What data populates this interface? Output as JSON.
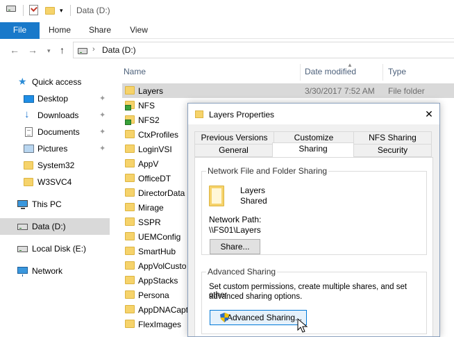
{
  "window": {
    "title": "Data (D:)"
  },
  "ribbon": {
    "tabs": [
      "File",
      "Home",
      "Share",
      "View"
    ]
  },
  "address": {
    "path": "Data (D:)"
  },
  "nav": {
    "items": [
      {
        "label": "Quick access",
        "icon": "star-icon",
        "pinned": false
      },
      {
        "label": "Desktop",
        "icon": "desktop-icon",
        "pinned": true
      },
      {
        "label": "Downloads",
        "icon": "download-icon",
        "pinned": true
      },
      {
        "label": "Documents",
        "icon": "documents-icon",
        "pinned": true
      },
      {
        "label": "Pictures",
        "icon": "pictures-icon",
        "pinned": true
      },
      {
        "label": "System32",
        "icon": "folder-icon",
        "pinned": false
      },
      {
        "label": "W3SVC4",
        "icon": "folder-icon",
        "pinned": false
      },
      {
        "label": "This PC",
        "icon": "pc-icon",
        "pinned": false
      },
      {
        "label": "Data (D:)",
        "icon": "drive-icon",
        "pinned": false,
        "selected": true
      },
      {
        "label": "Local Disk (E:)",
        "icon": "drive-icon",
        "pinned": false
      },
      {
        "label": "Network",
        "icon": "network-icon",
        "pinned": false
      }
    ]
  },
  "filelist": {
    "columns": {
      "name": "Name",
      "date": "Date modified",
      "type": "Type"
    },
    "rows": [
      {
        "name": "Layers",
        "date": "3/30/2017 7:52 AM",
        "type": "File folder",
        "selected": true,
        "shared": false
      },
      {
        "name": "NFS",
        "date": "",
        "type": "",
        "shared": true
      },
      {
        "name": "NFS2",
        "date": "",
        "type": "",
        "shared": true
      },
      {
        "name": "CtxProfiles",
        "date": "",
        "type": ""
      },
      {
        "name": "LoginVSI",
        "date": "",
        "type": ""
      },
      {
        "name": "AppV",
        "date": "",
        "type": ""
      },
      {
        "name": "OfficeDT",
        "date": "",
        "type": ""
      },
      {
        "name": "DirectorData",
        "date": "",
        "type": ""
      },
      {
        "name": "Mirage",
        "date": "",
        "type": ""
      },
      {
        "name": "SSPR",
        "date": "",
        "type": ""
      },
      {
        "name": "UEMConfig",
        "date": "",
        "type": ""
      },
      {
        "name": "SmartHub",
        "date": "",
        "type": ""
      },
      {
        "name": "AppVolCusto",
        "date": "",
        "type": ""
      },
      {
        "name": "AppStacks",
        "date": "",
        "type": ""
      },
      {
        "name": "Persona",
        "date": "",
        "type": ""
      },
      {
        "name": "AppDNACapt",
        "date": "",
        "type": ""
      },
      {
        "name": "FlexImages",
        "date": "",
        "type": ""
      }
    ]
  },
  "dialog": {
    "title": "Layers Properties",
    "close": "✕",
    "tabs_back": [
      "Previous Versions",
      "Customize",
      "NFS Sharing"
    ],
    "tabs_front": [
      "General",
      "Sharing",
      "Security"
    ],
    "active_tab": "Sharing",
    "network_sharing": {
      "group_title": "Network File and Folder Sharing",
      "folder_name": "Layers",
      "status": "Shared",
      "path_label": "Network Path:",
      "path_value": "\\\\FS01\\Layers",
      "share_button": "Share..."
    },
    "advanced_sharing": {
      "group_title": "Advanced Sharing",
      "description_line1": "Set custom permissions, create multiple shares, and set other",
      "description_line2": "advanced sharing options.",
      "button": "Advanced Sharing..."
    }
  },
  "colors": {
    "file_tab": "#1979ca",
    "selection": "#d9d9d9",
    "accent": "#0078d7"
  }
}
